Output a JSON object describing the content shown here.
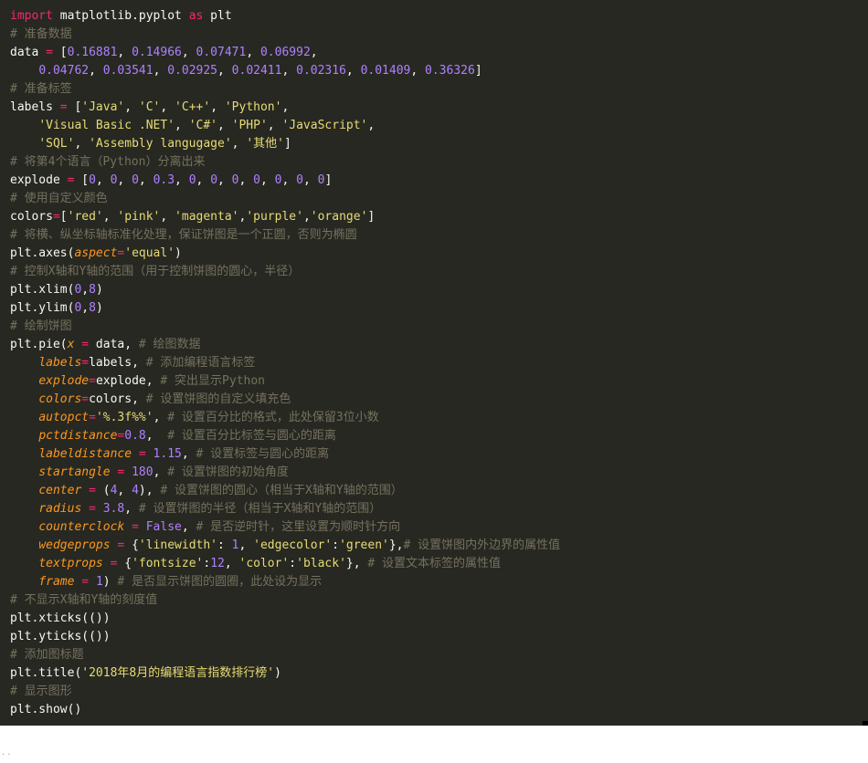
{
  "editor": {
    "lines": [
      [
        {
          "t": "kw",
          "v": "import"
        },
        {
          "t": "pl",
          "v": " matplotlib.pyplot "
        },
        {
          "t": "kw",
          "v": "as"
        },
        {
          "t": "pl",
          "v": " plt"
        }
      ],
      [
        {
          "t": "cm",
          "v": "# 准备数据"
        }
      ],
      [
        {
          "t": "pl",
          "v": "data "
        },
        {
          "t": "kw",
          "v": "="
        },
        {
          "t": "pl",
          "v": " ["
        },
        {
          "t": "num",
          "v": "0.16881"
        },
        {
          "t": "pl",
          "v": ", "
        },
        {
          "t": "num",
          "v": "0.14966"
        },
        {
          "t": "pl",
          "v": ", "
        },
        {
          "t": "num",
          "v": "0.07471"
        },
        {
          "t": "pl",
          "v": ", "
        },
        {
          "t": "num",
          "v": "0.06992"
        },
        {
          "t": "pl",
          "v": ","
        }
      ],
      [
        {
          "t": "pl",
          "v": "    "
        },
        {
          "t": "num",
          "v": "0.04762"
        },
        {
          "t": "pl",
          "v": ", "
        },
        {
          "t": "num",
          "v": "0.03541"
        },
        {
          "t": "pl",
          "v": ", "
        },
        {
          "t": "num",
          "v": "0.02925"
        },
        {
          "t": "pl",
          "v": ", "
        },
        {
          "t": "num",
          "v": "0.02411"
        },
        {
          "t": "pl",
          "v": ", "
        },
        {
          "t": "num",
          "v": "0.02316"
        },
        {
          "t": "pl",
          "v": ", "
        },
        {
          "t": "num",
          "v": "0.01409"
        },
        {
          "t": "pl",
          "v": ", "
        },
        {
          "t": "num",
          "v": "0.36326"
        },
        {
          "t": "pl",
          "v": "]"
        }
      ],
      [
        {
          "t": "cm",
          "v": "# 准备标签"
        }
      ],
      [
        {
          "t": "pl",
          "v": "labels "
        },
        {
          "t": "kw",
          "v": "="
        },
        {
          "t": "pl",
          "v": " ["
        },
        {
          "t": "str",
          "v": "'Java'"
        },
        {
          "t": "pl",
          "v": ", "
        },
        {
          "t": "str",
          "v": "'C'"
        },
        {
          "t": "pl",
          "v": ", "
        },
        {
          "t": "str",
          "v": "'C++'"
        },
        {
          "t": "pl",
          "v": ", "
        },
        {
          "t": "str",
          "v": "'Python'"
        },
        {
          "t": "pl",
          "v": ","
        }
      ],
      [
        {
          "t": "pl",
          "v": "    "
        },
        {
          "t": "str",
          "v": "'Visual Basic .NET'"
        },
        {
          "t": "pl",
          "v": ", "
        },
        {
          "t": "str",
          "v": "'C#'"
        },
        {
          "t": "pl",
          "v": ", "
        },
        {
          "t": "str",
          "v": "'PHP'"
        },
        {
          "t": "pl",
          "v": ", "
        },
        {
          "t": "str",
          "v": "'JavaScript'"
        },
        {
          "t": "pl",
          "v": ","
        }
      ],
      [
        {
          "t": "pl",
          "v": "    "
        },
        {
          "t": "str",
          "v": "'SQL'"
        },
        {
          "t": "pl",
          "v": ", "
        },
        {
          "t": "str",
          "v": "'Assembly langugage'"
        },
        {
          "t": "pl",
          "v": ", "
        },
        {
          "t": "str",
          "v": "'其他'"
        },
        {
          "t": "pl",
          "v": "]"
        }
      ],
      [
        {
          "t": "cm",
          "v": "# 将第4个语言（Python）分离出来"
        }
      ],
      [
        {
          "t": "pl",
          "v": "explode "
        },
        {
          "t": "kw",
          "v": "="
        },
        {
          "t": "pl",
          "v": " ["
        },
        {
          "t": "num",
          "v": "0"
        },
        {
          "t": "pl",
          "v": ", "
        },
        {
          "t": "num",
          "v": "0"
        },
        {
          "t": "pl",
          "v": ", "
        },
        {
          "t": "num",
          "v": "0"
        },
        {
          "t": "pl",
          "v": ", "
        },
        {
          "t": "num",
          "v": "0.3"
        },
        {
          "t": "pl",
          "v": ", "
        },
        {
          "t": "num",
          "v": "0"
        },
        {
          "t": "pl",
          "v": ", "
        },
        {
          "t": "num",
          "v": "0"
        },
        {
          "t": "pl",
          "v": ", "
        },
        {
          "t": "num",
          "v": "0"
        },
        {
          "t": "pl",
          "v": ", "
        },
        {
          "t": "num",
          "v": "0"
        },
        {
          "t": "pl",
          "v": ", "
        },
        {
          "t": "num",
          "v": "0"
        },
        {
          "t": "pl",
          "v": ", "
        },
        {
          "t": "num",
          "v": "0"
        },
        {
          "t": "pl",
          "v": ", "
        },
        {
          "t": "num",
          "v": "0"
        },
        {
          "t": "pl",
          "v": "]"
        }
      ],
      [
        {
          "t": "cm",
          "v": "# 使用自定义颜色"
        }
      ],
      [
        {
          "t": "pl",
          "v": "colors"
        },
        {
          "t": "kw",
          "v": "="
        },
        {
          "t": "pl",
          "v": "["
        },
        {
          "t": "str",
          "v": "'red'"
        },
        {
          "t": "pl",
          "v": ", "
        },
        {
          "t": "str",
          "v": "'pink'"
        },
        {
          "t": "pl",
          "v": ", "
        },
        {
          "t": "str",
          "v": "'magenta'"
        },
        {
          "t": "pl",
          "v": ","
        },
        {
          "t": "str",
          "v": "'purple'"
        },
        {
          "t": "pl",
          "v": ","
        },
        {
          "t": "str",
          "v": "'orange'"
        },
        {
          "t": "pl",
          "v": "]"
        }
      ],
      [
        {
          "t": "cm",
          "v": "# 将横、纵坐标轴标准化处理，保证饼图是一个正圆，否则为椭圆"
        }
      ],
      [
        {
          "t": "pl",
          "v": "plt.axes("
        },
        {
          "t": "kwarg",
          "v": "aspect"
        },
        {
          "t": "kw",
          "v": "="
        },
        {
          "t": "str",
          "v": "'equal'"
        },
        {
          "t": "pl",
          "v": ")"
        }
      ],
      [
        {
          "t": "cm",
          "v": "# 控制X轴和Y轴的范围（用于控制饼图的圆心，半径）"
        }
      ],
      [
        {
          "t": "pl",
          "v": "plt.xlim("
        },
        {
          "t": "num",
          "v": "0"
        },
        {
          "t": "pl",
          "v": ","
        },
        {
          "t": "num",
          "v": "8"
        },
        {
          "t": "pl",
          "v": ")"
        }
      ],
      [
        {
          "t": "pl",
          "v": "plt.ylim("
        },
        {
          "t": "num",
          "v": "0"
        },
        {
          "t": "pl",
          "v": ","
        },
        {
          "t": "num",
          "v": "8"
        },
        {
          "t": "pl",
          "v": ")"
        }
      ],
      [
        {
          "t": "cm",
          "v": "# 绘制饼图"
        }
      ],
      [
        {
          "t": "pl",
          "v": "plt.pie("
        },
        {
          "t": "kwarg",
          "v": "x"
        },
        {
          "t": "pl",
          "v": " "
        },
        {
          "t": "kw",
          "v": "="
        },
        {
          "t": "pl",
          "v": " data, "
        },
        {
          "t": "cm",
          "v": "# 绘图数据"
        }
      ],
      [
        {
          "t": "pl",
          "v": "    "
        },
        {
          "t": "kwarg",
          "v": "labels"
        },
        {
          "t": "kw",
          "v": "="
        },
        {
          "t": "pl",
          "v": "labels, "
        },
        {
          "t": "cm",
          "v": "# 添加编程语言标签"
        }
      ],
      [
        {
          "t": "pl",
          "v": "    "
        },
        {
          "t": "kwarg",
          "v": "explode"
        },
        {
          "t": "kw",
          "v": "="
        },
        {
          "t": "pl",
          "v": "explode, "
        },
        {
          "t": "cm",
          "v": "# 突出显示Python"
        }
      ],
      [
        {
          "t": "pl",
          "v": "    "
        },
        {
          "t": "kwarg",
          "v": "colors"
        },
        {
          "t": "kw",
          "v": "="
        },
        {
          "t": "pl",
          "v": "colors, "
        },
        {
          "t": "cm",
          "v": "# 设置饼图的自定义填充色"
        }
      ],
      [
        {
          "t": "pl",
          "v": "    "
        },
        {
          "t": "kwarg",
          "v": "autopct"
        },
        {
          "t": "kw",
          "v": "="
        },
        {
          "t": "str",
          "v": "'%.3f%%'"
        },
        {
          "t": "pl",
          "v": ", "
        },
        {
          "t": "cm",
          "v": "# 设置百分比的格式，此处保留3位小数"
        }
      ],
      [
        {
          "t": "pl",
          "v": "    "
        },
        {
          "t": "kwarg",
          "v": "pctdistance"
        },
        {
          "t": "kw",
          "v": "="
        },
        {
          "t": "num",
          "v": "0.8"
        },
        {
          "t": "pl",
          "v": ",  "
        },
        {
          "t": "cm",
          "v": "# 设置百分比标签与圆心的距离"
        }
      ],
      [
        {
          "t": "pl",
          "v": "    "
        },
        {
          "t": "kwarg",
          "v": "labeldistance"
        },
        {
          "t": "pl",
          "v": " "
        },
        {
          "t": "kw",
          "v": "="
        },
        {
          "t": "pl",
          "v": " "
        },
        {
          "t": "num",
          "v": "1.15"
        },
        {
          "t": "pl",
          "v": ", "
        },
        {
          "t": "cm",
          "v": "# 设置标签与圆心的距离"
        }
      ],
      [
        {
          "t": "pl",
          "v": "    "
        },
        {
          "t": "kwarg",
          "v": "startangle"
        },
        {
          "t": "pl",
          "v": " "
        },
        {
          "t": "kw",
          "v": "="
        },
        {
          "t": "pl",
          "v": " "
        },
        {
          "t": "num",
          "v": "180"
        },
        {
          "t": "pl",
          "v": ", "
        },
        {
          "t": "cm",
          "v": "# 设置饼图的初始角度"
        }
      ],
      [
        {
          "t": "pl",
          "v": "    "
        },
        {
          "t": "kwarg",
          "v": "center"
        },
        {
          "t": "pl",
          "v": " "
        },
        {
          "t": "kw",
          "v": "="
        },
        {
          "t": "pl",
          "v": " ("
        },
        {
          "t": "num",
          "v": "4"
        },
        {
          "t": "pl",
          "v": ", "
        },
        {
          "t": "num",
          "v": "4"
        },
        {
          "t": "pl",
          "v": "), "
        },
        {
          "t": "cm",
          "v": "# 设置饼图的圆心（相当于X轴和Y轴的范围）"
        }
      ],
      [
        {
          "t": "pl",
          "v": "    "
        },
        {
          "t": "kwarg",
          "v": "radius"
        },
        {
          "t": "pl",
          "v": " "
        },
        {
          "t": "kw",
          "v": "="
        },
        {
          "t": "pl",
          "v": " "
        },
        {
          "t": "num",
          "v": "3.8"
        },
        {
          "t": "pl",
          "v": ", "
        },
        {
          "t": "cm",
          "v": "# 设置饼图的半径（相当于X轴和Y轴的范围）"
        }
      ],
      [
        {
          "t": "pl",
          "v": "    "
        },
        {
          "t": "kwarg",
          "v": "counterclock"
        },
        {
          "t": "pl",
          "v": " "
        },
        {
          "t": "kw",
          "v": "="
        },
        {
          "t": "pl",
          "v": " "
        },
        {
          "t": "num",
          "v": "False"
        },
        {
          "t": "pl",
          "v": ", "
        },
        {
          "t": "cm",
          "v": "# 是否逆时针，这里设置为顺时针方向"
        }
      ],
      [
        {
          "t": "pl",
          "v": "    "
        },
        {
          "t": "kwarg",
          "v": "wedgeprops"
        },
        {
          "t": "pl",
          "v": " "
        },
        {
          "t": "kw",
          "v": "="
        },
        {
          "t": "pl",
          "v": " {"
        },
        {
          "t": "str",
          "v": "'linewidth'"
        },
        {
          "t": "pl",
          "v": ": "
        },
        {
          "t": "num",
          "v": "1"
        },
        {
          "t": "pl",
          "v": ", "
        },
        {
          "t": "str",
          "v": "'edgecolor'"
        },
        {
          "t": "pl",
          "v": ":"
        },
        {
          "t": "str",
          "v": "'green'"
        },
        {
          "t": "pl",
          "v": "},"
        },
        {
          "t": "cm",
          "v": "# 设置饼图内外边界的属性值"
        }
      ],
      [
        {
          "t": "pl",
          "v": "    "
        },
        {
          "t": "kwarg",
          "v": "textprops"
        },
        {
          "t": "pl",
          "v": " "
        },
        {
          "t": "kw",
          "v": "="
        },
        {
          "t": "pl",
          "v": " {"
        },
        {
          "t": "str",
          "v": "'fontsize'"
        },
        {
          "t": "pl",
          "v": ":"
        },
        {
          "t": "num",
          "v": "12"
        },
        {
          "t": "pl",
          "v": ", "
        },
        {
          "t": "str",
          "v": "'color'"
        },
        {
          "t": "pl",
          "v": ":"
        },
        {
          "t": "str",
          "v": "'black'"
        },
        {
          "t": "pl",
          "v": "}, "
        },
        {
          "t": "cm",
          "v": "# 设置文本标签的属性值"
        }
      ],
      [
        {
          "t": "pl",
          "v": "    "
        },
        {
          "t": "kwarg",
          "v": "frame"
        },
        {
          "t": "pl",
          "v": " "
        },
        {
          "t": "kw",
          "v": "="
        },
        {
          "t": "pl",
          "v": " "
        },
        {
          "t": "num",
          "v": "1"
        },
        {
          "t": "pl",
          "v": ") "
        },
        {
          "t": "cm",
          "v": "# 是否显示饼图的圆圈，此处设为显示"
        }
      ],
      [
        {
          "t": "cm",
          "v": "# 不显示X轴和Y轴的刻度值"
        }
      ],
      [
        {
          "t": "pl",
          "v": "plt.xticks(())"
        }
      ],
      [
        {
          "t": "pl",
          "v": "plt.yticks(())"
        }
      ],
      [
        {
          "t": "cm",
          "v": "# 添加图标题"
        }
      ],
      [
        {
          "t": "pl",
          "v": "plt.title("
        },
        {
          "t": "str",
          "v": "'2018年8月的编程语言指数排行榜'"
        },
        {
          "t": "pl",
          "v": ")"
        }
      ],
      [
        {
          "t": "cm",
          "v": "# 显示图形"
        }
      ],
      [
        {
          "t": "pl",
          "v": "plt.show()"
        }
      ]
    ]
  },
  "footer": {
    "text": "· ·"
  },
  "colors": {
    "background": "#272822",
    "keyword": "#f92672",
    "string": "#e6db74",
    "number": "#ae81ff",
    "kwarg": "#fd971f",
    "comment": "#75715e",
    "plain": "#f8f8f2",
    "accent": "#e8b64b"
  }
}
